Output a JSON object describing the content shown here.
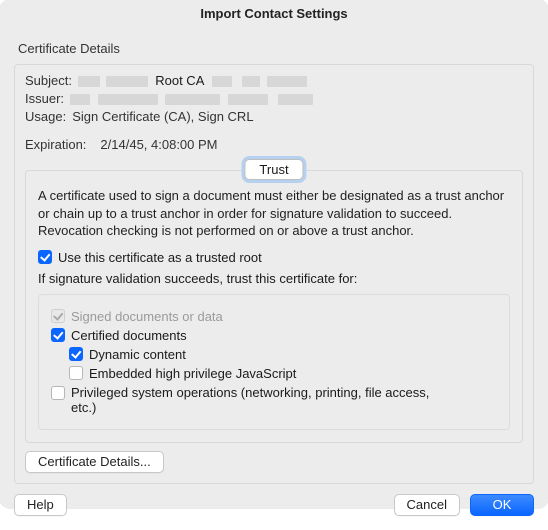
{
  "window": {
    "title": "Import Contact Settings"
  },
  "section": {
    "title": "Certificate Details"
  },
  "fields": {
    "subject_label": "Subject:",
    "subject_fragment": "Root CA",
    "issuer_label": "Issuer:",
    "usage_label": "Usage:",
    "usage_value": "Sign Certificate (CA), Sign CRL",
    "expiration_label": "Expiration:",
    "expiration_value": "2/14/45, 4:08:00 PM"
  },
  "trust": {
    "tab": "Trust",
    "description": "A certificate used to sign a document must either be designated as a trust anchor or chain up to a trust anchor in order for signature validation to succeed.  Revocation checking is not performed on or above a trust anchor.",
    "use_trusted_root": {
      "label": "Use this certificate as a trusted root",
      "checked": true
    },
    "if_succeeds": "If signature validation succeeds, trust this certificate for:",
    "signed_docs": {
      "label": "Signed documents or data",
      "checked": true,
      "disabled": true
    },
    "certified_docs": {
      "label": "Certified documents",
      "checked": true
    },
    "dynamic_content": {
      "label": "Dynamic content",
      "checked": true
    },
    "high_priv_js": {
      "label": "Embedded high privilege JavaScript",
      "checked": false
    },
    "priv_sys_ops": {
      "label": "Privileged system operations (networking, printing, file access, etc.)",
      "checked": false
    }
  },
  "buttons": {
    "cert_details": "Certificate Details...",
    "help": "Help",
    "cancel": "Cancel",
    "ok": "OK"
  }
}
